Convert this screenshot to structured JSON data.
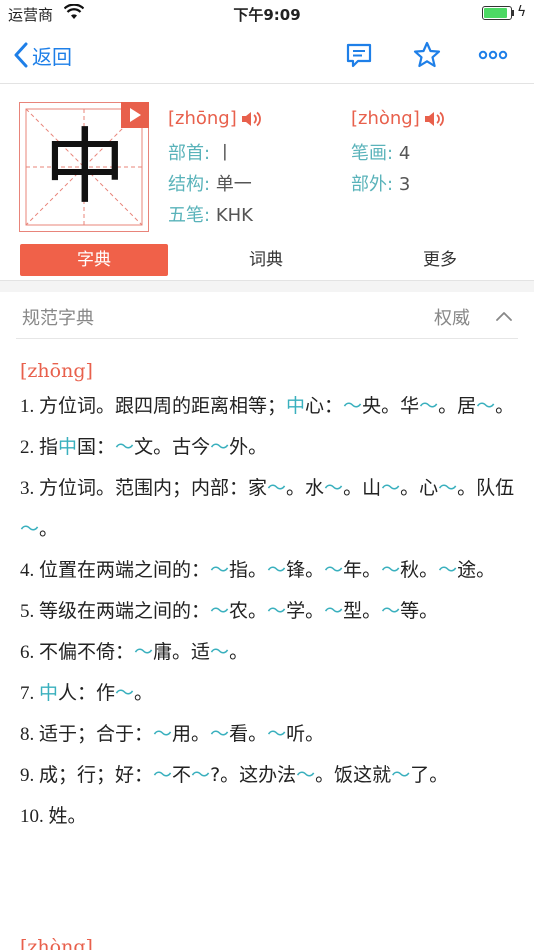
{
  "status": {
    "carrier": "运营商",
    "time": "下午9:09",
    "battery_level": 0.9
  },
  "nav": {
    "back_label": "返回"
  },
  "char": {
    "character": "中",
    "pinyin1": "[zhōng]",
    "pinyin2": "[zhòng]",
    "radical_label": "部首:",
    "radical_value": "丨",
    "strokes_label": "笔画:",
    "strokes_value": "4",
    "structure_label": "结构:",
    "structure_value": "单一",
    "outside_label": "部外:",
    "outside_value": "3",
    "wubi_label": "五笔:",
    "wubi_value": "KHK"
  },
  "tabs": [
    {
      "label": "字典",
      "active": true
    },
    {
      "label": "词典",
      "active": false
    },
    {
      "label": "更多",
      "active": false
    }
  ],
  "section": {
    "title": "规范字典",
    "authority": "权威"
  },
  "entry": {
    "pinyin": "[zhōng]",
    "pinyin_next": "[zhòng]",
    "defs": [
      {
        "num": "1. ",
        "parts": [
          [
            "方位词。跟四周的距离相等；",
            0
          ],
          [
            "中",
            1
          ],
          [
            "心：",
            0
          ],
          [
            "～",
            1
          ],
          [
            "央。华",
            0
          ],
          [
            "～",
            1
          ],
          [
            "。居",
            0
          ],
          [
            "～",
            1
          ],
          [
            "。",
            0
          ]
        ]
      },
      {
        "num": "2. ",
        "parts": [
          [
            "指",
            0
          ],
          [
            "中",
            1
          ],
          [
            "国：",
            0
          ],
          [
            "～",
            1
          ],
          [
            "文。古今",
            0
          ],
          [
            "～",
            1
          ],
          [
            "外。",
            0
          ]
        ]
      },
      {
        "num": "3. ",
        "parts": [
          [
            "方位词。范围内；内部：家",
            0
          ],
          [
            "～",
            1
          ],
          [
            "。水",
            0
          ],
          [
            "～",
            1
          ],
          [
            "。山",
            0
          ],
          [
            "～",
            1
          ],
          [
            "。心",
            0
          ],
          [
            "～",
            1
          ],
          [
            "。队伍",
            0
          ],
          [
            "～",
            1
          ],
          [
            "。",
            0
          ]
        ]
      },
      {
        "num": "4. ",
        "parts": [
          [
            "位置在两端之间的：",
            0
          ],
          [
            "～",
            1
          ],
          [
            "指。",
            0
          ],
          [
            "～",
            1
          ],
          [
            "锋。",
            0
          ],
          [
            "～",
            1
          ],
          [
            "年。",
            0
          ],
          [
            "～",
            1
          ],
          [
            "秋。",
            0
          ],
          [
            "～",
            1
          ],
          [
            "途。",
            0
          ]
        ]
      },
      {
        "num": "5. ",
        "parts": [
          [
            "等级在两端之间的：",
            0
          ],
          [
            "～",
            1
          ],
          [
            "农。",
            0
          ],
          [
            "～",
            1
          ],
          [
            "学。",
            0
          ],
          [
            "～",
            1
          ],
          [
            "型。",
            0
          ],
          [
            "～",
            1
          ],
          [
            "等。",
            0
          ]
        ]
      },
      {
        "num": "6. ",
        "parts": [
          [
            "不偏不倚：",
            0
          ],
          [
            "～",
            1
          ],
          [
            "庸。适",
            0
          ],
          [
            "～",
            1
          ],
          [
            "。",
            0
          ]
        ]
      },
      {
        "num": "7. ",
        "parts": [
          [
            "中",
            1
          ],
          [
            "人：作",
            0
          ],
          [
            "～",
            1
          ],
          [
            "。",
            0
          ]
        ]
      },
      {
        "num": "8. ",
        "parts": [
          [
            "适于；合于：",
            0
          ],
          [
            "～",
            1
          ],
          [
            "用。",
            0
          ],
          [
            "～",
            1
          ],
          [
            "看。",
            0
          ],
          [
            "～",
            1
          ],
          [
            "听。",
            0
          ]
        ]
      },
      {
        "num": "9. ",
        "parts": [
          [
            "成；行；好：",
            0
          ],
          [
            "～",
            1
          ],
          [
            "不",
            0
          ],
          [
            "～",
            1
          ],
          [
            "?。这办法",
            0
          ],
          [
            "～",
            1
          ],
          [
            "。饭这就",
            0
          ],
          [
            "～",
            1
          ],
          [
            "了。",
            0
          ]
        ]
      },
      {
        "num": "10. ",
        "parts": [
          [
            "姓。",
            0
          ]
        ]
      }
    ]
  },
  "colors": {
    "accent": "#f06149",
    "link_blue": "#1e7fe8",
    "teal": "#3ab0be"
  }
}
